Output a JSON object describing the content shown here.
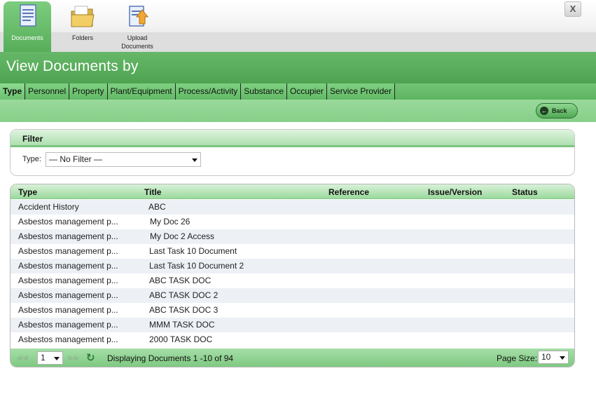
{
  "toolbar": {
    "items": [
      {
        "label": "Documents",
        "icon": "documents-icon"
      },
      {
        "label": "Folders",
        "icon": "folders-icon"
      },
      {
        "label": "Upload Documents",
        "icon": "upload-documents-icon"
      }
    ],
    "close_label": "X"
  },
  "header": {
    "title": "View Documents by"
  },
  "tabs": [
    "Type",
    "Personnel",
    "Property",
    "Plant/Equipment",
    "Process/Activity",
    "Substance",
    "Occupier",
    "Service Provider"
  ],
  "actions": {
    "back_label": "Back"
  },
  "filter": {
    "title": "Filter",
    "type_label": "Type:",
    "type_value": "— No Filter —"
  },
  "grid": {
    "columns": [
      "Type",
      "Title",
      "Reference",
      "Issue/Version",
      "Status"
    ],
    "rows": [
      {
        "type": "Accident History",
        "title": "ABC"
      },
      {
        "type": "Asbestos management p...",
        "title": "My Doc 26"
      },
      {
        "type": "Asbestos management p...",
        "title": "My Doc 2 Access"
      },
      {
        "type": "Asbestos management p...",
        "title": "Last Task 10 Document"
      },
      {
        "type": "Asbestos management p...",
        "title": "Last Task 10 Document 2"
      },
      {
        "type": "Asbestos management p...",
        "title": "ABC TASK DOC"
      },
      {
        "type": "Asbestos management p...",
        "title": "ABC TASK DOC 2"
      },
      {
        "type": "Asbestos management p...",
        "title": "ABC TASK DOC 3"
      },
      {
        "type": "Asbestos management p...",
        "title": "MMM TASK DOC"
      },
      {
        "type": "Asbestos management p...",
        "title": "2000 TASK DOC"
      }
    ],
    "pager": {
      "page": "1",
      "display_text": "Displaying Documents 1 -10 of 94",
      "page_size_label": "Page Size:",
      "page_size": "10"
    }
  },
  "colors": {
    "accent": "#57ae59",
    "header": "#5aae5c",
    "row_alt": "#edf1f6"
  }
}
